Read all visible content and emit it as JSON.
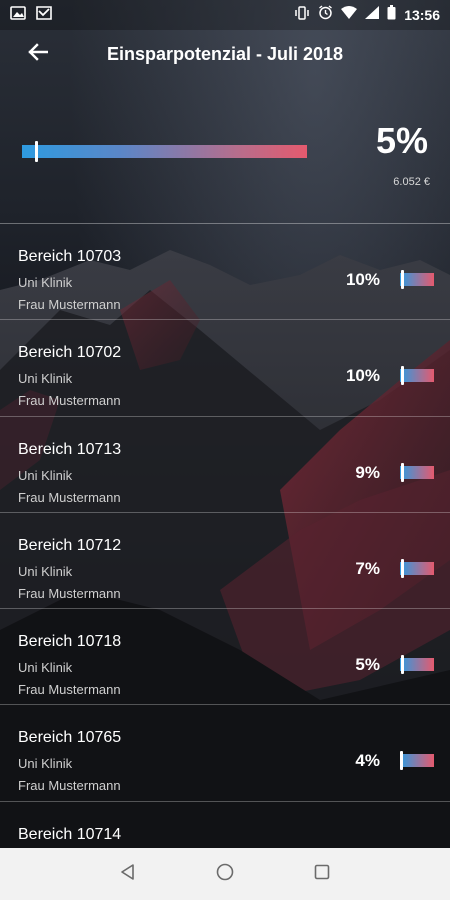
{
  "status_bar": {
    "time": "13:56",
    "left_icons": [
      "image-icon",
      "inbox-icon"
    ],
    "right_icons": [
      "vibrate-icon",
      "alarm-icon",
      "wifi-icon",
      "signal-icon",
      "battery-icon"
    ]
  },
  "header": {
    "title": "Einsparpotenzial - Juli 2018"
  },
  "summary": {
    "percent": "5%",
    "amount": "6.052 €",
    "level": 0.05
  },
  "items": [
    {
      "title": "Bereich 10703",
      "subtitle": "Uni Klinik",
      "person": "Frau Mustermann",
      "percent": "10%",
      "level": 0.1
    },
    {
      "title": "Bereich 10702",
      "subtitle": "Uni Klinik",
      "person": "Frau Mustermann",
      "percent": "10%",
      "level": 0.1
    },
    {
      "title": "Bereich 10713",
      "subtitle": "Uni Klinik",
      "person": "Frau Mustermann",
      "percent": "9%",
      "level": 0.09
    },
    {
      "title": "Bereich 10712",
      "subtitle": "Uni Klinik",
      "person": "Frau Mustermann",
      "percent": "7%",
      "level": 0.07
    },
    {
      "title": "Bereich 10718",
      "subtitle": "Uni Klinik",
      "person": "Frau Mustermann",
      "percent": "5%",
      "level": 0.05
    },
    {
      "title": "Bereich 10765",
      "subtitle": "Uni Klinik",
      "person": "Frau Mustermann",
      "percent": "4%",
      "level": 0.04
    },
    {
      "title": "Bereich 10714",
      "subtitle": "",
      "person": "",
      "percent": "",
      "level": null
    }
  ],
  "colors": {
    "bar_start": "#2e9be0",
    "bar_end": "#e55a6e",
    "nav_bar": "#f2f2f2"
  },
  "nav": {
    "icons": [
      "back-triangle-icon",
      "home-circle-icon",
      "recents-square-icon"
    ]
  }
}
